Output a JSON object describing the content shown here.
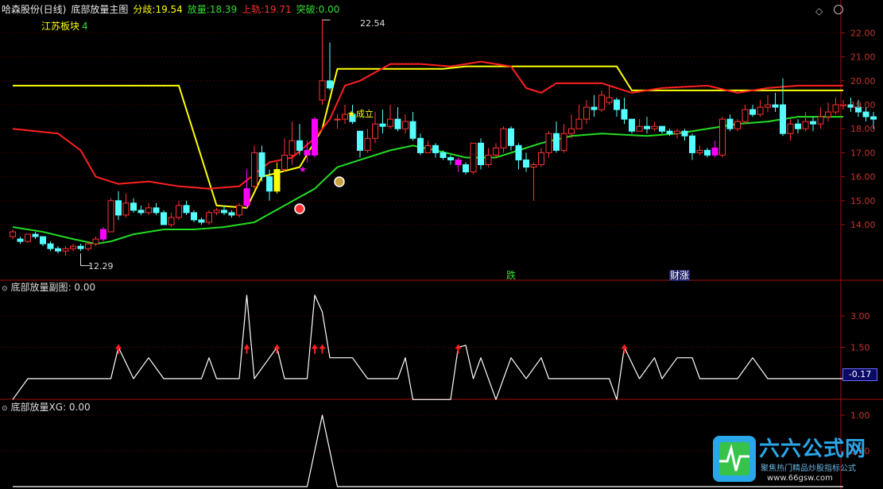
{
  "header": {
    "stock": "哈森股份(日线)",
    "indicator": "底部放量主图",
    "fenqi_label": "分歧:",
    "fenqi_value": "19.54",
    "fangliang_label": "放量:",
    "fangliang_value": "18.39",
    "shanggui_label": "上轨:",
    "shanggui_value": "19.71",
    "tupo_label": "突破:",
    "tupo_value": "0.00",
    "sector": "江苏板块",
    "sector_count": "4"
  },
  "sub1": {
    "title": "底部放量副图",
    "value": ": 0.00",
    "current": "-0.17"
  },
  "sub2": {
    "title": "底部放量XG",
    "value": ": 0.00"
  },
  "annotations": {
    "high": "22.54",
    "low": "12.29",
    "chengli": "成立",
    "die": "跌",
    "caizhang": "财涨"
  },
  "colors": {
    "up": "#ff3232",
    "down": "#54ffff",
    "magenta": "#ff00ff",
    "yellow": "#ffff00",
    "red_line": "#ff2020",
    "green_line": "#22dd22",
    "grid": "#8b0000",
    "axis_text": "#c83232"
  },
  "watermark": {
    "title": "六六公式网",
    "subtitle": "聚焦热门精品炒股指标公式",
    "url": "www.66gsw.com"
  },
  "chart_data": {
    "type": "candlestick",
    "main": {
      "y_ticks": [
        14.0,
        15.0,
        16.0,
        17.0,
        18.0,
        19.0,
        20.0,
        21.0,
        22.0
      ],
      "candles": [
        [
          13.5,
          13.7,
          13.8,
          13.4
        ],
        [
          13.4,
          13.3,
          13.5,
          13.2
        ],
        [
          13.3,
          13.6,
          13.6,
          13.25
        ],
        [
          13.6,
          13.5,
          13.7,
          13.4
        ],
        [
          13.5,
          13.2,
          13.5,
          13.1
        ],
        [
          13.2,
          13.0,
          13.3,
          12.9
        ],
        [
          13.0,
          12.9,
          13.1,
          12.8
        ],
        [
          12.9,
          13.0,
          13.1,
          12.7
        ],
        [
          13.0,
          13.1,
          13.2,
          12.9
        ],
        [
          13.1,
          13.0,
          13.2,
          12.9
        ],
        [
          13.0,
          13.2,
          13.3,
          12.9
        ],
        [
          13.2,
          13.4,
          13.5,
          13.1
        ],
        [
          13.4,
          13.8,
          13.9,
          13.3
        ],
        [
          13.7,
          15.0,
          15.1,
          13.7
        ],
        [
          15.0,
          14.4,
          15.4,
          14.2
        ],
        [
          14.4,
          14.9,
          15.3,
          14.3
        ],
        [
          14.9,
          14.6,
          15.1,
          14.5
        ],
        [
          14.6,
          14.5,
          14.8,
          14.4
        ],
        [
          14.5,
          14.7,
          14.9,
          14.4
        ],
        [
          14.7,
          14.5,
          14.9,
          14.4
        ],
        [
          14.5,
          14.0,
          14.6,
          14.0
        ],
        [
          14.0,
          14.3,
          14.5,
          13.9
        ],
        [
          14.3,
          14.8,
          15.0,
          14.2
        ],
        [
          14.8,
          14.5,
          15.0,
          14.4
        ],
        [
          14.5,
          14.2,
          14.6,
          14.1
        ],
        [
          14.2,
          14.1,
          14.3,
          14.0
        ],
        [
          14.1,
          14.5,
          14.6,
          14.0
        ],
        [
          14.5,
          14.6,
          14.7,
          14.4
        ],
        [
          14.6,
          14.5,
          14.8,
          14.4
        ],
        [
          14.5,
          14.4,
          14.6,
          14.3
        ],
        [
          14.4,
          14.8,
          14.9,
          14.3
        ],
        [
          14.8,
          15.5,
          16.3,
          14.7
        ],
        [
          15.6,
          17.0,
          17.3,
          15.5
        ],
        [
          17.0,
          16.0,
          17.3,
          15.8
        ],
        [
          16.0,
          15.4,
          16.3,
          15.0
        ],
        [
          15.4,
          16.3,
          16.6,
          15.3
        ],
        [
          16.3,
          16.9,
          17.6,
          16.2
        ],
        [
          16.9,
          17.5,
          18.3,
          16.5
        ],
        [
          17.5,
          17.1,
          18.2,
          16.9
        ],
        [
          17.1,
          16.9,
          17.5,
          16.6
        ],
        [
          16.9,
          18.4,
          18.5,
          16.8
        ],
        [
          19.2,
          20.0,
          22.54,
          19.0
        ],
        [
          20.0,
          19.7,
          21.6,
          19.6
        ],
        [
          18.4,
          18.4,
          18.6,
          18.0
        ],
        [
          18.4,
          18.6,
          19.0,
          18.2
        ],
        [
          18.6,
          18.3,
          19.0,
          18.2
        ],
        [
          17.9,
          17.1,
          17.3,
          16.8
        ],
        [
          17.1,
          17.6,
          18.0,
          17.0
        ],
        [
          17.6,
          18.2,
          18.7,
          17.4
        ],
        [
          18.2,
          18.1,
          18.8,
          17.8
        ],
        [
          18.1,
          18.4,
          19.0,
          18.0
        ],
        [
          18.4,
          18.0,
          18.9,
          17.9
        ],
        [
          18.0,
          18.3,
          18.6,
          17.8
        ],
        [
          18.3,
          17.6,
          18.7,
          17.5
        ],
        [
          17.6,
          17.0,
          17.8,
          16.9
        ],
        [
          17.0,
          17.3,
          17.5,
          17.0
        ],
        [
          17.3,
          17.0,
          17.4,
          16.8
        ],
        [
          17.0,
          16.8,
          17.1,
          16.7
        ],
        [
          16.8,
          16.7,
          16.9,
          16.5
        ],
        [
          16.7,
          16.5,
          16.8,
          16.2
        ],
        [
          16.5,
          16.2,
          16.6,
          16.1
        ],
        [
          16.2,
          17.4,
          17.4,
          16.1
        ],
        [
          17.4,
          16.5,
          17.6,
          16.3
        ],
        [
          16.5,
          16.9,
          17.2,
          16.4
        ],
        [
          16.9,
          17.2,
          17.4,
          16.8
        ],
        [
          17.2,
          18.0,
          18.1,
          17.0
        ],
        [
          18.0,
          17.3,
          18.1,
          17.1
        ],
        [
          17.3,
          16.7,
          17.4,
          16.3
        ],
        [
          16.7,
          16.4,
          17.0,
          16.2
        ],
        [
          16.4,
          16.5,
          16.6,
          15.0
        ],
        [
          16.5,
          17.0,
          17.2,
          16.4
        ],
        [
          17.0,
          17.8,
          17.9,
          16.8
        ],
        [
          17.8,
          17.1,
          18.3,
          17.0
        ],
        [
          17.1,
          17.8,
          18.2,
          17.0
        ],
        [
          17.8,
          18.0,
          18.6,
          17.6
        ],
        [
          18.0,
          18.4,
          19.0,
          18.0
        ],
        [
          18.4,
          18.9,
          19.2,
          18.2
        ],
        [
          18.9,
          18.8,
          19.4,
          18.5
        ],
        [
          18.8,
          19.4,
          19.6,
          18.7
        ],
        [
          19.1,
          19.3,
          19.8,
          19.0
        ],
        [
          19.2,
          18.8,
          19.3,
          18.5
        ],
        [
          18.8,
          18.4,
          19.3,
          18.2
        ],
        [
          18.4,
          17.9,
          18.4,
          17.8
        ],
        [
          17.9,
          18.1,
          18.4,
          17.9
        ],
        [
          18.1,
          18.0,
          18.5,
          17.8
        ],
        [
          18.0,
          18.1,
          18.3,
          17.9
        ],
        [
          18.1,
          17.9,
          18.1,
          17.8
        ],
        [
          17.9,
          17.8,
          18.0,
          17.7
        ],
        [
          17.8,
          17.9,
          18.0,
          17.6
        ],
        [
          17.9,
          17.7,
          18.0,
          17.5
        ],
        [
          17.7,
          17.0,
          17.8,
          16.7
        ],
        [
          17.0,
          17.1,
          17.3,
          16.9
        ],
        [
          17.1,
          16.9,
          17.2,
          16.8
        ],
        [
          16.9,
          17.2,
          17.5,
          16.8
        ],
        [
          16.9,
          18.4,
          18.5,
          16.8
        ],
        [
          18.4,
          18.0,
          18.6,
          17.9
        ],
        [
          18.0,
          18.3,
          18.4,
          17.9
        ],
        [
          18.3,
          18.8,
          19.0,
          18.2
        ],
        [
          18.8,
          18.6,
          19.0,
          18.5
        ],
        [
          18.6,
          18.9,
          19.2,
          18.5
        ],
        [
          18.9,
          19.0,
          19.4,
          18.7
        ],
        [
          19.0,
          18.9,
          19.5,
          18.7
        ],
        [
          19.0,
          17.8,
          20.1,
          17.7
        ],
        [
          17.8,
          18.2,
          18.4,
          17.5
        ],
        [
          18.2,
          18.0,
          18.4,
          17.8
        ],
        [
          18.0,
          18.3,
          18.7,
          17.9
        ],
        [
          18.3,
          18.2,
          18.5,
          17.9
        ],
        [
          18.2,
          18.5,
          18.9,
          18.0
        ],
        [
          18.5,
          18.7,
          19.1,
          18.3
        ],
        [
          18.7,
          19.0,
          19.3,
          18.6
        ],
        [
          19.0,
          19.0,
          19.2,
          18.8
        ],
        [
          19.0,
          18.9,
          19.3,
          18.7
        ],
        [
          18.9,
          18.7,
          19.2,
          18.5
        ],
        [
          18.7,
          18.5,
          18.9,
          18.3
        ],
        [
          18.5,
          18.4,
          18.7,
          18.0
        ]
      ],
      "magenta_candles": [
        12,
        31,
        39,
        40,
        59,
        93
      ],
      "yellow_candles": [
        35
      ],
      "yellow_line": [
        [
          0,
          19.8
        ],
        [
          22,
          19.8
        ],
        [
          27,
          14.8
        ],
        [
          31,
          14.7
        ],
        [
          33,
          16.0
        ],
        [
          38,
          16.4
        ],
        [
          41,
          18.0
        ],
        [
          43,
          20.5
        ],
        [
          57,
          20.5
        ],
        [
          60,
          20.6
        ],
        [
          80,
          20.6
        ],
        [
          82,
          19.6
        ],
        [
          110,
          19.6
        ]
      ],
      "red_line": [
        [
          0,
          18.0
        ],
        [
          6,
          17.8
        ],
        [
          9,
          17.1
        ],
        [
          11,
          16.0
        ],
        [
          14,
          15.7
        ],
        [
          18,
          15.8
        ],
        [
          22,
          15.6
        ],
        [
          26,
          15.5
        ],
        [
          30,
          15.6
        ],
        [
          34,
          16.6
        ],
        [
          37,
          16.8
        ],
        [
          40,
          17.6
        ],
        [
          42,
          18.4
        ],
        [
          44,
          19.8
        ],
        [
          46,
          20.0
        ],
        [
          50,
          20.7
        ],
        [
          54,
          20.7
        ],
        [
          58,
          20.6
        ],
        [
          62,
          20.8
        ],
        [
          66,
          20.6
        ],
        [
          68,
          19.7
        ],
        [
          70,
          19.5
        ],
        [
          72,
          19.9
        ],
        [
          78,
          19.9
        ],
        [
          82,
          19.5
        ],
        [
          86,
          19.7
        ],
        [
          92,
          19.8
        ],
        [
          96,
          19.5
        ],
        [
          100,
          19.7
        ],
        [
          104,
          19.8
        ],
        [
          110,
          19.8
        ]
      ],
      "green_line": [
        [
          0,
          13.9
        ],
        [
          4,
          13.7
        ],
        [
          8,
          13.4
        ],
        [
          11,
          13.2
        ],
        [
          13,
          13.3
        ],
        [
          16,
          13.6
        ],
        [
          20,
          13.8
        ],
        [
          24,
          13.8
        ],
        [
          28,
          13.9
        ],
        [
          32,
          14.1
        ],
        [
          36,
          14.8
        ],
        [
          40,
          15.5
        ],
        [
          43,
          16.4
        ],
        [
          46,
          16.7
        ],
        [
          50,
          17.1
        ],
        [
          53,
          17.3
        ],
        [
          56,
          17.1
        ],
        [
          60,
          16.8
        ],
        [
          64,
          16.8
        ],
        [
          67,
          17.1
        ],
        [
          70,
          17.4
        ],
        [
          74,
          17.7
        ],
        [
          78,
          17.8
        ],
        [
          84,
          17.7
        ],
        [
          88,
          17.8
        ],
        [
          92,
          18.0
        ],
        [
          96,
          18.2
        ],
        [
          100,
          18.3
        ],
        [
          104,
          18.5
        ],
        [
          110,
          18.5
        ]
      ]
    },
    "sub1": {
      "y_ticks": [
        1.5,
        3.0
      ],
      "last_value": -0.17,
      "line": [
        [
          0,
          -1
        ],
        [
          2,
          0
        ],
        [
          13,
          0
        ],
        [
          14,
          1.5
        ],
        [
          16,
          0
        ],
        [
          18,
          1
        ],
        [
          20,
          0
        ],
        [
          25,
          0
        ],
        [
          26,
          1
        ],
        [
          27,
          0
        ],
        [
          30,
          0
        ],
        [
          31,
          4
        ],
        [
          32,
          0
        ],
        [
          34,
          1
        ],
        [
          35,
          1.5
        ],
        [
          36,
          0
        ],
        [
          39,
          0
        ],
        [
          40,
          4
        ],
        [
          41,
          3.2
        ],
        [
          42,
          1
        ],
        [
          45,
          1
        ],
        [
          47,
          0
        ],
        [
          51,
          0
        ],
        [
          52,
          1
        ],
        [
          53,
          -1
        ],
        [
          58,
          -1
        ],
        [
          59,
          1.5
        ],
        [
          60,
          1.6
        ],
        [
          61,
          0
        ],
        [
          62,
          1
        ],
        [
          64,
          -1
        ],
        [
          65,
          0
        ],
        [
          66,
          1
        ],
        [
          68,
          0
        ],
        [
          70,
          1
        ],
        [
          71,
          0
        ],
        [
          79,
          0
        ],
        [
          80,
          -1
        ],
        [
          81,
          1.5
        ],
        [
          83,
          0
        ],
        [
          85,
          1
        ],
        [
          86,
          0
        ],
        [
          88,
          1
        ],
        [
          90,
          1
        ],
        [
          91,
          0
        ],
        [
          96,
          0
        ],
        [
          98,
          1
        ],
        [
          100,
          0
        ],
        [
          110,
          0
        ]
      ],
      "up_arrows": [
        14,
        31,
        35,
        40,
        41,
        59,
        81
      ]
    },
    "sub2": {
      "y_ticks": [
        0.5,
        1.0
      ],
      "line": [
        [
          0,
          0
        ],
        [
          39,
          0
        ],
        [
          41,
          1
        ],
        [
          43,
          0
        ],
        [
          110,
          0
        ]
      ]
    }
  }
}
